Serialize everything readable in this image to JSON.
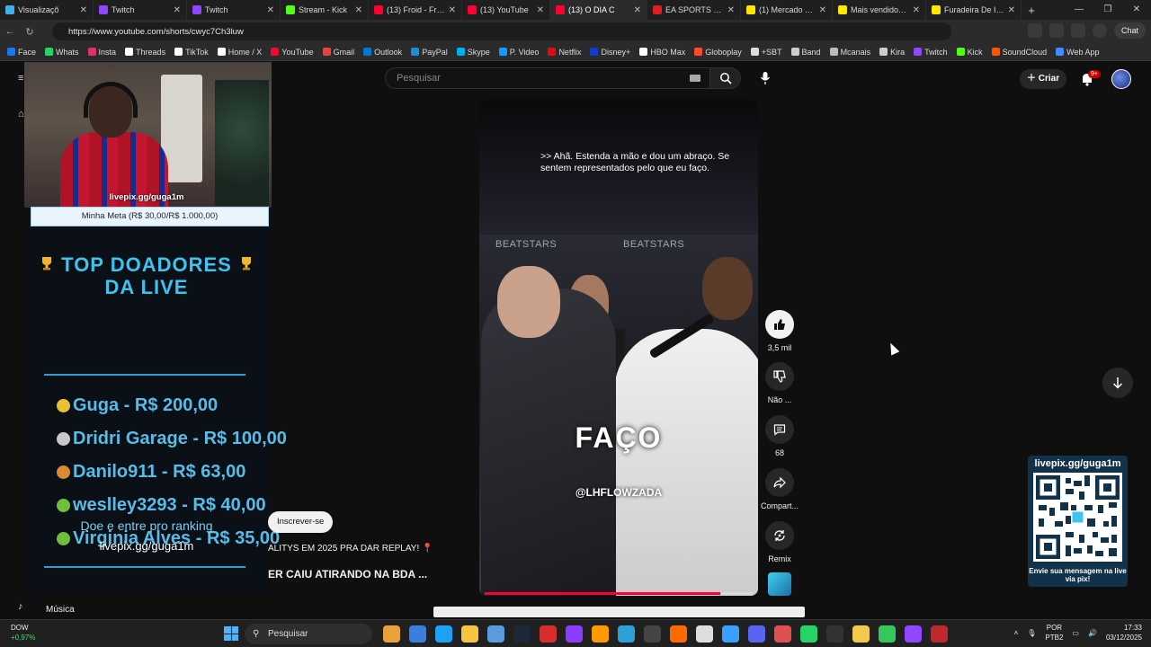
{
  "browser": {
    "tabs": [
      {
        "title": "Visualizaçõ",
        "color": "#3fb3e8",
        "active": false
      },
      {
        "title": "Twitch",
        "color": "#9146ff",
        "active": false
      },
      {
        "title": "Twitch",
        "color": "#9146ff",
        "active": false
      },
      {
        "title": "Stream - Kick",
        "color": "#53fc18",
        "active": false
      },
      {
        "title": "(13) Froid - Fran",
        "color": "#ff0033",
        "active": false
      },
      {
        "title": "(13) YouTube",
        "color": "#ff0033",
        "active": false
      },
      {
        "title": "(13) O DIA C",
        "color": "#ff0033",
        "active": true
      },
      {
        "title": "EA SPORTS FC 26",
        "color": "#e02020",
        "active": false
      },
      {
        "title": "(1) Mercado Livre",
        "color": "#ffe600",
        "active": false
      },
      {
        "title": "Mais vendidos | M",
        "color": "#ffe600",
        "active": false
      },
      {
        "title": "Furadeira De Imp",
        "color": "#ffe600",
        "active": false
      }
    ],
    "url": "https://www.youtube.com/shorts/cwyc7Ch3luw",
    "chat_label": "Chat",
    "bookmarks": [
      {
        "label": "Face",
        "color": "#1877f2"
      },
      {
        "label": "Whats",
        "color": "#25d366"
      },
      {
        "label": "Insta",
        "color": "#e1306c"
      },
      {
        "label": "Threads",
        "color": "#ffffff"
      },
      {
        "label": "TikTok",
        "color": "#ffffff"
      },
      {
        "label": "Home / X",
        "color": "#ffffff"
      },
      {
        "label": "YouTube",
        "color": "#ff0033"
      },
      {
        "label": "Gmail",
        "color": "#ea4335"
      },
      {
        "label": "Outlook",
        "color": "#0078d4"
      },
      {
        "label": "PayPal",
        "color": "#1a8ddb"
      },
      {
        "label": "Skype",
        "color": "#00aff0"
      },
      {
        "label": "P. Video",
        "color": "#1399ff"
      },
      {
        "label": "Netflix",
        "color": "#e50914"
      },
      {
        "label": "Disney+",
        "color": "#113ccf"
      },
      {
        "label": "HBO Max",
        "color": "#ffffff"
      },
      {
        "label": "Globoplay",
        "color": "#ff4b2b"
      },
      {
        "label": "+SBT",
        "color": "#dddddd"
      },
      {
        "label": "Band",
        "color": "#cccccc"
      },
      {
        "label": "Mcanais",
        "color": "#bbbbbb"
      },
      {
        "label": "Kira",
        "color": "#cccccc"
      },
      {
        "label": "Twitch",
        "color": "#9146ff"
      },
      {
        "label": "Kick",
        "color": "#53fc18"
      },
      {
        "label": "SoundCloud",
        "color": "#ff5500"
      },
      {
        "label": "Web App",
        "color": "#3f8cff"
      }
    ]
  },
  "youtube": {
    "search_placeholder": "Pesquisar",
    "create_label": "Criar",
    "notifications_badge": "9+",
    "sidebar_music": "Música",
    "subscribe_label": "Inscrever-se",
    "prev_line1": "ALITYS EM 2025 PRA DAR REPLAY! 📍",
    "prev_line2": "ER CAIU ATIRANDO NA BDA ..."
  },
  "overlay": {
    "webcam_label": "livepix.gg/guga1m",
    "meta": "Minha Meta (R$ 30,00/R$ 1.000,00)",
    "title_line1": "TOP DOADORES",
    "title_line2": "DA LIVE",
    "donors": [
      {
        "text": "Guga - R$ 200,00",
        "medal": "#e8c032"
      },
      {
        "text": "Dridri Garage - R$ 100,00",
        "medal": "#c8c8c8"
      },
      {
        "text": "Danilo911 - R$ 63,00",
        "medal": "#d98a32"
      },
      {
        "text": "weslley3293 - R$ 40,00",
        "medal": "#6fbf3a"
      },
      {
        "text": "Virginia Alves - R$ 35,00",
        "medal": "#6fbf3a"
      }
    ],
    "donate_text": "Doe e entre pro ranking",
    "donate_link": "livepix.gg/guga1m",
    "qr_top": "livepix.gg/guga1m",
    "qr_bottom": "Envie sua mensagem na live via pix!"
  },
  "short": {
    "caption": ">> Ahã. Estenda a mão e dou um abraço. Se sentem representados pelo que eu faço.",
    "brand_left": "BEATSTARS",
    "brand_right": "BEATSTARS",
    "overlay_word": "FAÇO",
    "handle": "@LHFLOWZADA",
    "progress": 0.88,
    "likes": "3,5 mil",
    "dislike_label": "Não ...",
    "comments": "68",
    "share_label": "Compart...",
    "remix_label": "Remix"
  },
  "taskbar": {
    "weather_name": "DOW",
    "weather_change": "+0,97%",
    "search_label": "Pesquisar",
    "lang_line1": "POR",
    "lang_line2": "PTB2",
    "time": "17:33",
    "date": "03/12/2025",
    "apps": [
      "#e8a23a",
      "#3a7fe0",
      "#1da1f2",
      "#f5c542",
      "#5a9be0",
      "#1b2838",
      "#d62e2e",
      "#8a3cff",
      "#ff9900",
      "#2ea0d8",
      "#444444",
      "#ff6a00",
      "#dddddd",
      "#3aa0ff",
      "#5865f2",
      "#e05050",
      "#25d366",
      "#333333",
      "#f2c94c",
      "#34c759",
      "#9146ff",
      "#c0282d"
    ]
  }
}
